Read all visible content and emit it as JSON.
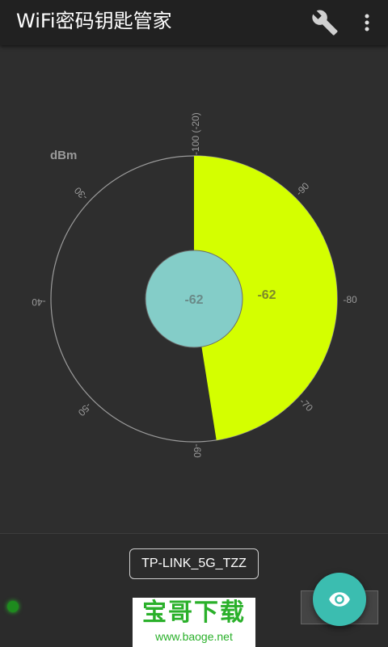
{
  "app": {
    "title": "WiFi密码钥匙管家"
  },
  "toolbar": {
    "tools_icon": "wrench-icon",
    "more_icon": "more-vert-icon"
  },
  "gauge": {
    "unit_label": "dBm",
    "center_value": "-62",
    "arc_value": "-62",
    "signal_level_dbm": -62,
    "scale_min_dbm": -100,
    "scale_max_dbm": -20,
    "fill_color": "#d4ff00",
    "center_color": "#84cdc8",
    "ticks": [
      "-100 (-20)",
      "-90",
      "-80",
      "-70",
      "-60",
      "-50",
      "-40",
      "-30"
    ]
  },
  "network": {
    "ssid": "TP-LINK_5G_TZZ"
  },
  "status": {
    "connected_color": "#1e8b1e"
  },
  "fab": {
    "icon": "eye-icon",
    "color": "#3bbdb0"
  },
  "watermark": {
    "brand": "宝哥下载",
    "url": "www.baoge.net"
  }
}
